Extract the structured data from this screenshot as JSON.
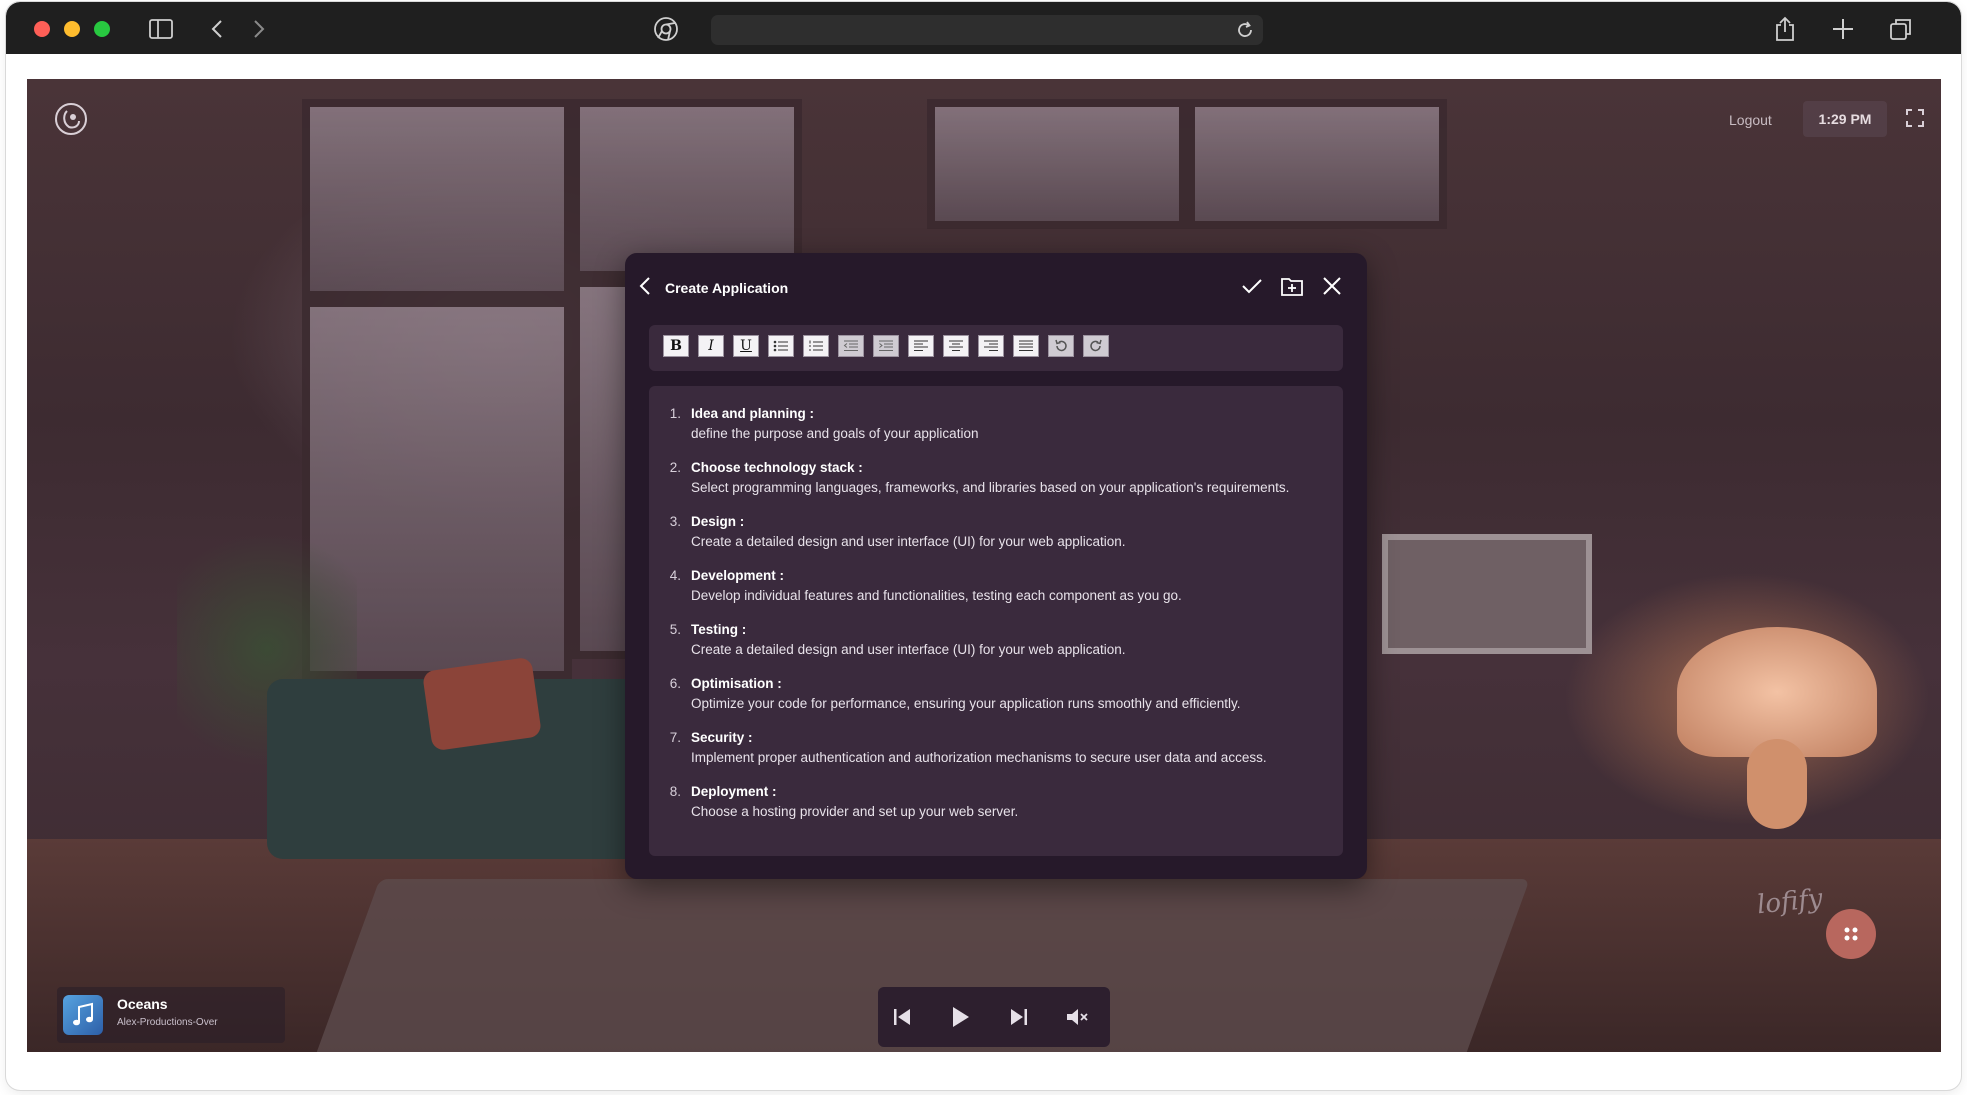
{
  "browser": {
    "url": ""
  },
  "app": {
    "logout_label": "Logout",
    "time": "1:29 PM"
  },
  "dialog": {
    "title": "Create Application",
    "toolbar": [
      {
        "name": "bold-tool",
        "glyph": "B"
      },
      {
        "name": "italic-tool",
        "glyph": "I"
      },
      {
        "name": "underline-tool",
        "glyph": "U"
      },
      {
        "name": "bullet-list-tool",
        "glyph": "list"
      },
      {
        "name": "numbered-list-tool",
        "glyph": "numlist"
      },
      {
        "name": "outdent-tool",
        "glyph": "outdent"
      },
      {
        "name": "indent-tool",
        "glyph": "indent"
      },
      {
        "name": "align-left-tool",
        "glyph": "left"
      },
      {
        "name": "align-center-tool",
        "glyph": "center"
      },
      {
        "name": "align-right-tool",
        "glyph": "right"
      },
      {
        "name": "justify-tool",
        "glyph": "justify"
      },
      {
        "name": "undo-tool",
        "glyph": "undo"
      },
      {
        "name": "redo-tool",
        "glyph": "redo"
      }
    ],
    "steps": [
      {
        "num": "1.",
        "title": "Idea and planning :",
        "desc": "define the purpose and goals of your application"
      },
      {
        "num": "2.",
        "title": "Choose technology stack :",
        "desc": "Select programming languages, frameworks, and libraries based on your application's requirements."
      },
      {
        "num": "3.",
        "title": "Design :",
        "desc": "Create a detailed design and user interface (UI) for your web application."
      },
      {
        "num": "4.",
        "title": "Development :",
        "desc": "Develop individual features and functionalities, testing each component as you go."
      },
      {
        "num": "5.",
        "title": "Testing :",
        "desc": "Create a detailed design and user interface (UI) for your web application."
      },
      {
        "num": "6.",
        "title": "Optimisation :",
        "desc": "Optimize your code for performance, ensuring your application runs smoothly and efficiently."
      },
      {
        "num": "7.",
        "title": "Security :",
        "desc": "Implement proper authentication and authorization mechanisms to secure user data and access."
      },
      {
        "num": "8.",
        "title": "Deployment :",
        "desc": "Choose a hosting provider and set up your web server."
      }
    ]
  },
  "now_playing": {
    "title": "Oceans",
    "artist": "Alex-Productions-Over"
  },
  "watermark": "lofify",
  "colors": {
    "dialog_bg": "#26192a",
    "panel_bg": "#3a2a3d",
    "fab": "#b8675e"
  }
}
